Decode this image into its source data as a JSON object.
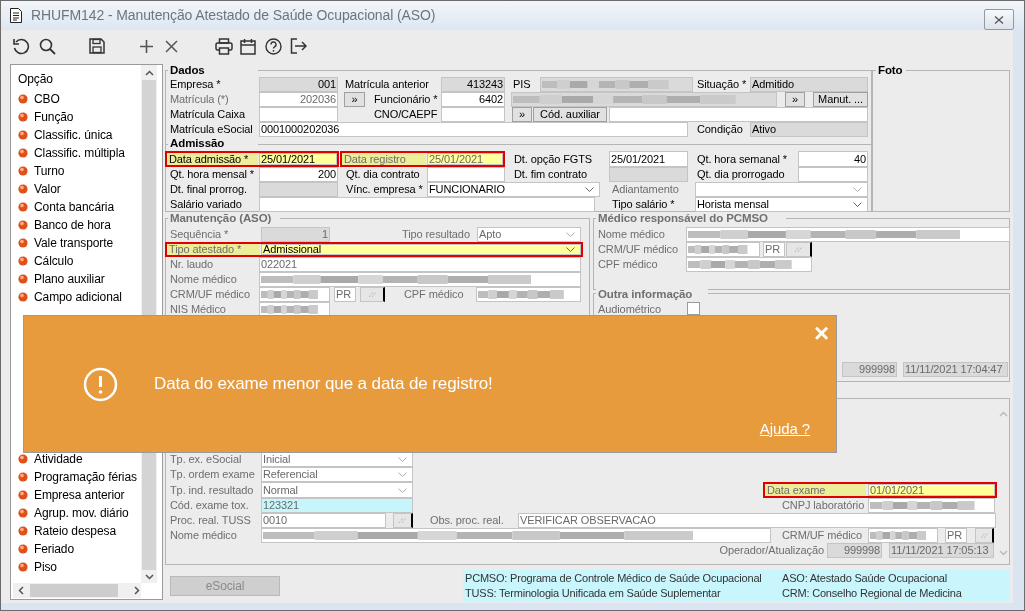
{
  "window": {
    "title": "RHUFM142 - Manutenção Atestado de Saúde Ocupacional (ASO)"
  },
  "sidebar": {
    "header": "Opção",
    "items_above_message": [
      "CBO",
      "Função",
      "Classific. única",
      "Classific. múltipla",
      "Turno",
      "Valor",
      "Conta bancária",
      "Banco de hora",
      "Vale transporte",
      "Cálculo",
      "Plano auxiliar",
      "Campo adicional"
    ],
    "items_below_message": [
      "Atividade",
      "Programação férias",
      "Empresa anterior",
      "Agrup. mov. diário",
      "Rateio despesa",
      "Feriado",
      "Piso"
    ]
  },
  "form": {
    "rows": [
      {
        "controls": [
          {
            "kind": "header",
            "text": "Dados",
            "disabled": false
          },
          {
            "kind": "header",
            "text": "Foto",
            "disabled": false
          }
        ]
      },
      {
        "controls": [
          {
            "kind": "label",
            "text": "Empresa *",
            "disabled": false
          },
          {
            "kind": "field",
            "value": "001",
            "readonly": true,
            "highlighted": false,
            "right_aligned": true,
            "disabled": false
          },
          {
            "kind": "label",
            "text": "Matrícula anterior",
            "disabled": false
          },
          {
            "kind": "field",
            "value": "413243",
            "readonly": true,
            "highlighted": false,
            "right_aligned": true,
            "disabled": false
          },
          {
            "kind": "label",
            "text": "PIS",
            "disabled": false
          },
          {
            "kind": "redacted",
            "readonly": true
          },
          {
            "kind": "label",
            "text": "Situação *",
            "disabled": false
          },
          {
            "kind": "field",
            "value": "Admitido",
            "readonly": true,
            "highlighted": false,
            "disabled": false
          }
        ]
      },
      {
        "controls": [
          {
            "kind": "label",
            "text": "Matrícula (*)",
            "disabled": true
          },
          {
            "kind": "field",
            "value": "202036",
            "readonly": false,
            "highlighted": false,
            "right_aligned": true,
            "disabled": true
          },
          {
            "kind": "button",
            "text": "»"
          },
          {
            "kind": "label",
            "text": "Funcionário *",
            "disabled": false
          },
          {
            "kind": "field",
            "value": "6402",
            "readonly": false,
            "highlighted": false,
            "right_aligned": true,
            "disabled": false
          },
          {
            "kind": "redacted",
            "readonly": true
          },
          {
            "kind": "button",
            "text": "»"
          },
          {
            "kind": "button",
            "text": "Manut. ..."
          }
        ]
      },
      {
        "controls": [
          {
            "kind": "label",
            "text": "Matrícula Caixa",
            "disabled": false
          },
          {
            "kind": "field",
            "readonly": false,
            "highlighted": false
          },
          {
            "kind": "label",
            "text": "CNO/CAEPF",
            "disabled": false
          },
          {
            "kind": "field",
            "readonly": false,
            "highlighted": false
          },
          {
            "kind": "button",
            "text": "»"
          },
          {
            "kind": "button",
            "text": "Cód. auxiliar"
          },
          {
            "kind": "field",
            "readonly": false,
            "highlighted": false
          }
        ]
      },
      {
        "controls": [
          {
            "kind": "label",
            "text": "Matrícula eSocial",
            "disabled": false
          },
          {
            "kind": "field",
            "value": "0001000202036",
            "readonly": false,
            "highlighted": false,
            "disabled": false
          },
          {
            "kind": "label",
            "text": "Condição",
            "disabled": false
          },
          {
            "kind": "field",
            "value": "Ativo",
            "readonly": true,
            "highlighted": false,
            "disabled": false
          }
        ]
      },
      {
        "controls": [
          {
            "kind": "header",
            "text": "Admissão",
            "disabled": false
          }
        ]
      },
      {
        "controls": [
          {
            "kind": "highlight",
            "controls": [
              {
                "kind": "label",
                "text": "Data admissão *",
                "disabled": false
              },
              {
                "kind": "field",
                "value": "25/01/2021",
                "highlighted": true,
                "disabled": false
              }
            ]
          },
          {
            "kind": "highlight",
            "controls": [
              {
                "kind": "label",
                "text": "Data registro",
                "disabled": true
              },
              {
                "kind": "field",
                "value": "25/01/2021",
                "highlighted": true,
                "disabled": true
              }
            ]
          },
          {
            "kind": "label",
            "text": "Dt. opção FGTS",
            "disabled": false
          },
          {
            "kind": "field",
            "value": "25/01/2021",
            "readonly": false,
            "highlighted": false,
            "disabled": false
          },
          {
            "kind": "label",
            "text": "Qt. hora semanal *",
            "disabled": false
          },
          {
            "kind": "field",
            "value": "40",
            "readonly": false,
            "highlighted": false,
            "right_aligned": true,
            "disabled": false
          }
        ]
      },
      {
        "controls": [
          {
            "kind": "label",
            "text": "Qt. hora mensal *",
            "disabled": false
          },
          {
            "kind": "field",
            "value": "200",
            "readonly": false,
            "highlighted": false,
            "right_aligned": true,
            "disabled": false
          },
          {
            "kind": "label",
            "text": "Qt. dia contrato",
            "disabled": false
          },
          {
            "kind": "field",
            "readonly": false,
            "highlighted": false
          },
          {
            "kind": "label",
            "text": "Dt. fim contrato",
            "disabled": false
          },
          {
            "kind": "field",
            "readonly": true,
            "highlighted": false
          },
          {
            "kind": "label",
            "text": "Qt. dia prorrogado",
            "disabled": false
          },
          {
            "kind": "field",
            "readonly": false,
            "highlighted": false
          }
        ]
      },
      {
        "controls": [
          {
            "kind": "label",
            "text": "Dt. final prorrog.",
            "disabled": false
          },
          {
            "kind": "field",
            "readonly": true,
            "highlighted": false
          },
          {
            "kind": "label",
            "text": "Vínc. empresa *",
            "disabled": false
          },
          {
            "kind": "select",
            "value": "FUNCIONARIO",
            "highlighted": false,
            "disabled": false
          },
          {
            "kind": "label",
            "text": "Adiantamento",
            "disabled": true
          },
          {
            "kind": "select",
            "highlighted": false,
            "disabled": true
          }
        ]
      },
      {
        "controls": [
          {
            "kind": "label",
            "text": "Salário variado",
            "disabled": false
          },
          {
            "kind": "field",
            "readonly": false,
            "highlighted": false
          },
          {
            "kind": "label",
            "text": "Tipo salário *",
            "disabled": false
          },
          {
            "kind": "select",
            "value": "Horista mensal",
            "highlighted": false,
            "disabled": false
          }
        ]
      },
      {
        "controls": [
          {
            "kind": "header",
            "text": "Manutenção (ASO)",
            "disabled": true
          },
          {
            "kind": "header",
            "text": "Médico responsável do PCMSO",
            "disabled": true
          }
        ]
      },
      {
        "controls": [
          {
            "kind": "label",
            "text": "Sequência *",
            "disabled": true
          },
          {
            "kind": "field",
            "value": "1",
            "readonly": true,
            "highlighted": false,
            "right_aligned": true,
            "disabled": true
          },
          {
            "kind": "label",
            "text": "Tipo resultado",
            "disabled": true
          },
          {
            "kind": "select",
            "value": "Apto",
            "highlighted": false,
            "disabled": true
          },
          {
            "kind": "label",
            "text": "Nome médico",
            "disabled": true
          },
          {
            "kind": "redacted",
            "readonly": false
          }
        ]
      },
      {
        "controls": [
          {
            "kind": "highlight",
            "controls": [
              {
                "kind": "label",
                "text": "Tipo atestado *",
                "disabled": true
              },
              {
                "kind": "select",
                "value": "Admissional",
                "highlighted": true,
                "disabled": false
              }
            ]
          },
          {
            "kind": "label",
            "text": "CRM/UF médico",
            "disabled": true
          },
          {
            "kind": "redacted",
            "readonly": false
          },
          {
            "kind": "field",
            "value": "PR",
            "readonly": false,
            "highlighted": false,
            "disabled": true
          },
          {
            "kind": "lookup"
          }
        ]
      },
      {
        "controls": [
          {
            "kind": "label",
            "text": "Nr. laudo",
            "disabled": true
          },
          {
            "kind": "field",
            "value": "022021",
            "readonly": false,
            "highlighted": false,
            "disabled": true
          },
          {
            "kind": "label",
            "text": "CPF médico",
            "disabled": true
          },
          {
            "kind": "redacted",
            "readonly": false
          }
        ]
      },
      {
        "controls": [
          {
            "kind": "label",
            "text": "Nome médico",
            "disabled": true
          },
          {
            "kind": "redacted",
            "readonly": false
          }
        ]
      },
      {
        "controls": [
          {
            "kind": "label",
            "text": "CRM/UF médico",
            "disabled": true
          },
          {
            "kind": "redacted",
            "readonly": false
          },
          {
            "kind": "field",
            "value": "PR",
            "readonly": false,
            "highlighted": false,
            "disabled": true
          },
          {
            "kind": "lookup"
          },
          {
            "kind": "label",
            "text": "CPF médico",
            "disabled": true
          },
          {
            "kind": "redacted",
            "readonly": false
          },
          {
            "kind": "header",
            "text": "Outra informação",
            "disabled": true
          }
        ]
      },
      {
        "controls": [
          {
            "kind": "label",
            "text": "NIS Médico",
            "disabled": true
          },
          {
            "kind": "redacted",
            "readonly": false
          },
          {
            "kind": "label",
            "text": "Audiométrico",
            "disabled": true
          },
          {
            "kind": "checkbox",
            "checked": false
          }
        ]
      },
      {
        "controls": [
          {
            "kind": "field",
            "value": "999998",
            "readonly": true,
            "highlighted": false,
            "right_aligned": true,
            "disabled": true
          },
          {
            "kind": "field",
            "value": "11/11/2021 17:04:47",
            "readonly": true,
            "highlighted": false,
            "disabled": true
          }
        ]
      },
      {
        "controls": [
          {
            "kind": "label",
            "text": "Tp. ex. eSocial",
            "disabled": true
          },
          {
            "kind": "select",
            "value": "Inicial",
            "highlighted": false,
            "disabled": true
          }
        ]
      },
      {
        "controls": [
          {
            "kind": "label",
            "text": "Tp. ordem exame",
            "disabled": true
          },
          {
            "kind": "select",
            "value": "Referencial",
            "highlighted": false,
            "disabled": true
          }
        ]
      },
      {
        "controls": [
          {
            "kind": "label",
            "text": "Tp. ind. resultado",
            "disabled": true
          },
          {
            "kind": "select",
            "value": "Normal",
            "highlighted": false,
            "disabled": true
          },
          {
            "kind": "highlight",
            "controls": [
              {
                "kind": "label",
                "text": "Data exame",
                "disabled": true
              },
              {
                "kind": "field",
                "value": "01/01/2021",
                "highlighted": true,
                "disabled": true
              }
            ]
          }
        ]
      },
      {
        "controls": [
          {
            "kind": "label",
            "text": "Cód. exame tox.",
            "disabled": true
          },
          {
            "kind": "field",
            "value": "123321",
            "highlighted": false,
            "focused": true,
            "disabled": true
          },
          {
            "kind": "label",
            "text": "CNPJ laboratório",
            "disabled": true
          },
          {
            "kind": "redacted",
            "readonly": false
          }
        ]
      },
      {
        "controls": [
          {
            "kind": "label",
            "text": "Proc. real. TUSS",
            "disabled": true
          },
          {
            "kind": "field",
            "value": "0010",
            "readonly": false,
            "highlighted": false,
            "disabled": true
          },
          {
            "kind": "lookup"
          },
          {
            "kind": "label",
            "text": "Obs. proc. real.",
            "disabled": true
          },
          {
            "kind": "field",
            "value": "VERIFICAR OBSERVACAO",
            "readonly": false,
            "highlighted": false,
            "disabled": true
          }
        ]
      },
      {
        "controls": [
          {
            "kind": "label",
            "text": "Nome médico",
            "disabled": true
          },
          {
            "kind": "redacted",
            "readonly": false
          },
          {
            "kind": "label",
            "text": "CRM/UF médico",
            "disabled": true
          },
          {
            "kind": "redacted",
            "readonly": false
          },
          {
            "kind": "field",
            "value": "PR",
            "readonly": false,
            "highlighted": false,
            "disabled": true
          },
          {
            "kind": "lookup"
          }
        ]
      },
      {
        "controls": [
          {
            "kind": "label",
            "text": "Operador/Atualização",
            "disabled": true,
            "right_aligned": true
          },
          {
            "kind": "field",
            "value": "999998",
            "readonly": true,
            "highlighted": false,
            "right_aligned": true,
            "disabled": true
          },
          {
            "kind": "field",
            "value": "11/11/2021 17:05:13",
            "readonly": true,
            "highlighted": false,
            "disabled": true
          }
        ]
      }
    ]
  },
  "esocial_button": {
    "label": "eSocial",
    "disabled": true
  },
  "legend": [
    "PCMSO: Programa de Controle Médico de Saúde Ocupacional",
    "ASO: Atestado Saúde Ocupacional",
    "TUSS: Terminologia Unificada em Saúde Suplementar",
    "CRM: Conselho Regional de Medicina"
  ],
  "message": {
    "text": "Data do exame menor que a data de registro!",
    "close": "×",
    "help_link": "Ajuda ?"
  }
}
